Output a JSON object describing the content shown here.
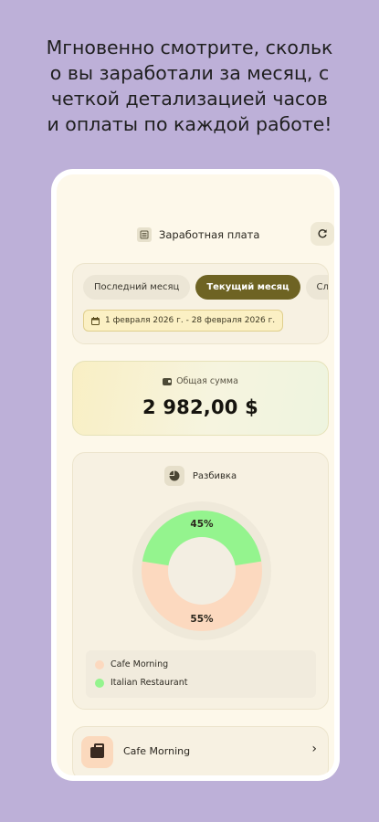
{
  "promo": {
    "lines": [
      "Мгновенно смотрите, скольк",
      "о вы заработали за месяц, с",
      "четкой детализацией часов",
      "и оплаты по каждой работе!"
    ]
  },
  "header": {
    "title": "Заработная плата",
    "title_icon": "calculator-icon",
    "refresh_icon": "refresh-icon"
  },
  "period": {
    "chips": [
      {
        "label": "Последний месяц",
        "active": false
      },
      {
        "label": "Текущий месяц",
        "active": true
      },
      {
        "label": "Сле",
        "active": false
      }
    ],
    "date_range": "1 февраля 2026 г. - 28 февраля 2026 г.",
    "date_icon": "calendar-icon"
  },
  "total": {
    "label": "Общая сумма",
    "value": "2 982,00 $",
    "icon": "wallet-icon"
  },
  "breakdown": {
    "title": "Разбивка",
    "icon": "pie-chart-icon",
    "slices": [
      {
        "name": "Cafe Morning",
        "percent": 55,
        "label": "55%",
        "color": "#fcd9bf"
      },
      {
        "name": "Italian Restaurant",
        "percent": 45,
        "label": "45%",
        "color": "#94f48e"
      }
    ]
  },
  "jobs": [
    {
      "name": "Cafe Morning",
      "icon": "briefcase-icon",
      "icon_bg": "#fbd9bd"
    }
  ],
  "colors": {
    "background": "#bdb0d8",
    "accent": "#6e6323",
    "screen": "#fdf8ea"
  }
}
